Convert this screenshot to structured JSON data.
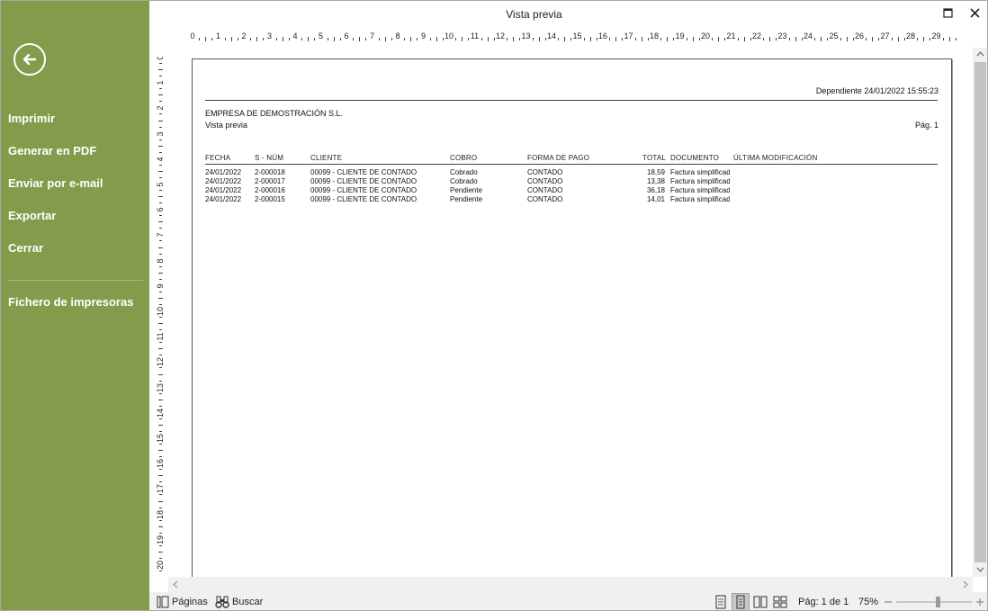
{
  "window": {
    "title": "Vista previa"
  },
  "sidebar": {
    "items": [
      {
        "label": "Imprimir"
      },
      {
        "label": "Generar en PDF"
      },
      {
        "label": "Enviar por e-mail"
      },
      {
        "label": "Exportar"
      },
      {
        "label": "Cerrar"
      },
      {
        "label": "Fichero de impresoras"
      }
    ]
  },
  "ruler": {
    "horizontal": [
      "0",
      "1",
      "2",
      "3",
      "4",
      "5",
      "6",
      "7",
      "8",
      "9",
      "10",
      "11",
      "12",
      "13",
      "14",
      "15",
      "16",
      "17",
      "18",
      "19",
      "20",
      "21",
      "22",
      "23",
      "24",
      "25",
      "26",
      "27",
      "28",
      "29"
    ],
    "vertical": [
      "0",
      "1",
      "2",
      "3",
      "4",
      "5",
      "6",
      "7",
      "8",
      "9",
      "10",
      "11",
      "12",
      "13",
      "14",
      "15",
      "16",
      "17",
      "18",
      "19",
      "20"
    ]
  },
  "report": {
    "dependiente": "Dependiente 24/01/2022 15:55:23",
    "company": "EMPRESA DE DEMOSTRACIÓN S.L.",
    "subtitle": "Vista previa",
    "page": "Pág. 1",
    "columns": [
      "FECHA",
      "S - NÚM",
      "CLIENTE",
      "COBRO",
      "FORMA DE PAGO",
      "TOTAL",
      "DOCUMENTO",
      "ÚLTIMA MODIFICACIÓN"
    ],
    "rows": [
      [
        "24/01/2022",
        "2-000018",
        "00099 - CLIENTE DE CONTADO",
        "Cobrado",
        "CONTADO",
        "18,59",
        "Factura simplificada"
      ],
      [
        "24/01/2022",
        "2-000017",
        "00099 - CLIENTE DE CONTADO",
        "Cobrado",
        "CONTADO",
        "13,38",
        "Factura simplificada"
      ],
      [
        "24/01/2022",
        "2-000016",
        "00099 - CLIENTE DE CONTADO",
        "Pendiente",
        "CONTADO",
        "36,18",
        "Factura simplificada"
      ],
      [
        "24/01/2022",
        "2-000015",
        "00099 - CLIENTE DE CONTADO",
        "Pendiente",
        "CONTADO",
        "14,01",
        "Factura simplificada"
      ]
    ]
  },
  "statusbar": {
    "pages_label": "Páginas",
    "search_label": "Buscar",
    "page_info": "Pág: 1 de 1",
    "zoom": "75%",
    "zoom_level": 0.55
  },
  "colors": {
    "sidebar": "#839c4c"
  },
  "icons": [
    "back-arrow-icon",
    "maximize-icon",
    "close-icon",
    "pages-icon",
    "binoculars-icon",
    "single-page-icon",
    "page-width-icon",
    "two-pages-icon",
    "multi-page-icon",
    "zoom-minus-icon",
    "zoom-plus-icon"
  ]
}
